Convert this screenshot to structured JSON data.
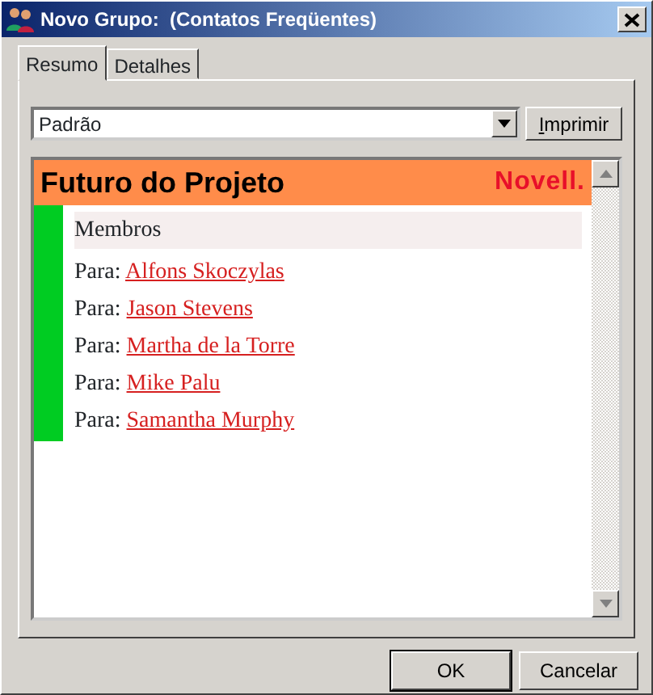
{
  "window": {
    "title": "Novo Grupo:  (Contatos Freqüentes)"
  },
  "tabs": [
    {
      "label": "Resumo",
      "selected": true
    },
    {
      "label": "Detalhes",
      "selected": false
    }
  ],
  "view_select": {
    "value": "Padrão"
  },
  "print_button": {
    "label": "Imprimir"
  },
  "summary": {
    "title": "Futuro do Projeto",
    "brand": "Novell.",
    "section": "Membros",
    "members": [
      {
        "prefix": "Para:",
        "name": "Alfons Skoczylas"
      },
      {
        "prefix": "Para:",
        "name": "Jason Stevens"
      },
      {
        "prefix": "Para:",
        "name": "Martha de la Torre"
      },
      {
        "prefix": "Para:",
        "name": "Mike Palu"
      },
      {
        "prefix": "Para:",
        "name": "Samantha Murphy"
      }
    ]
  },
  "buttons": [
    {
      "label": "OK",
      "default": true
    },
    {
      "label": "Cancelar",
      "default": false
    }
  ]
}
